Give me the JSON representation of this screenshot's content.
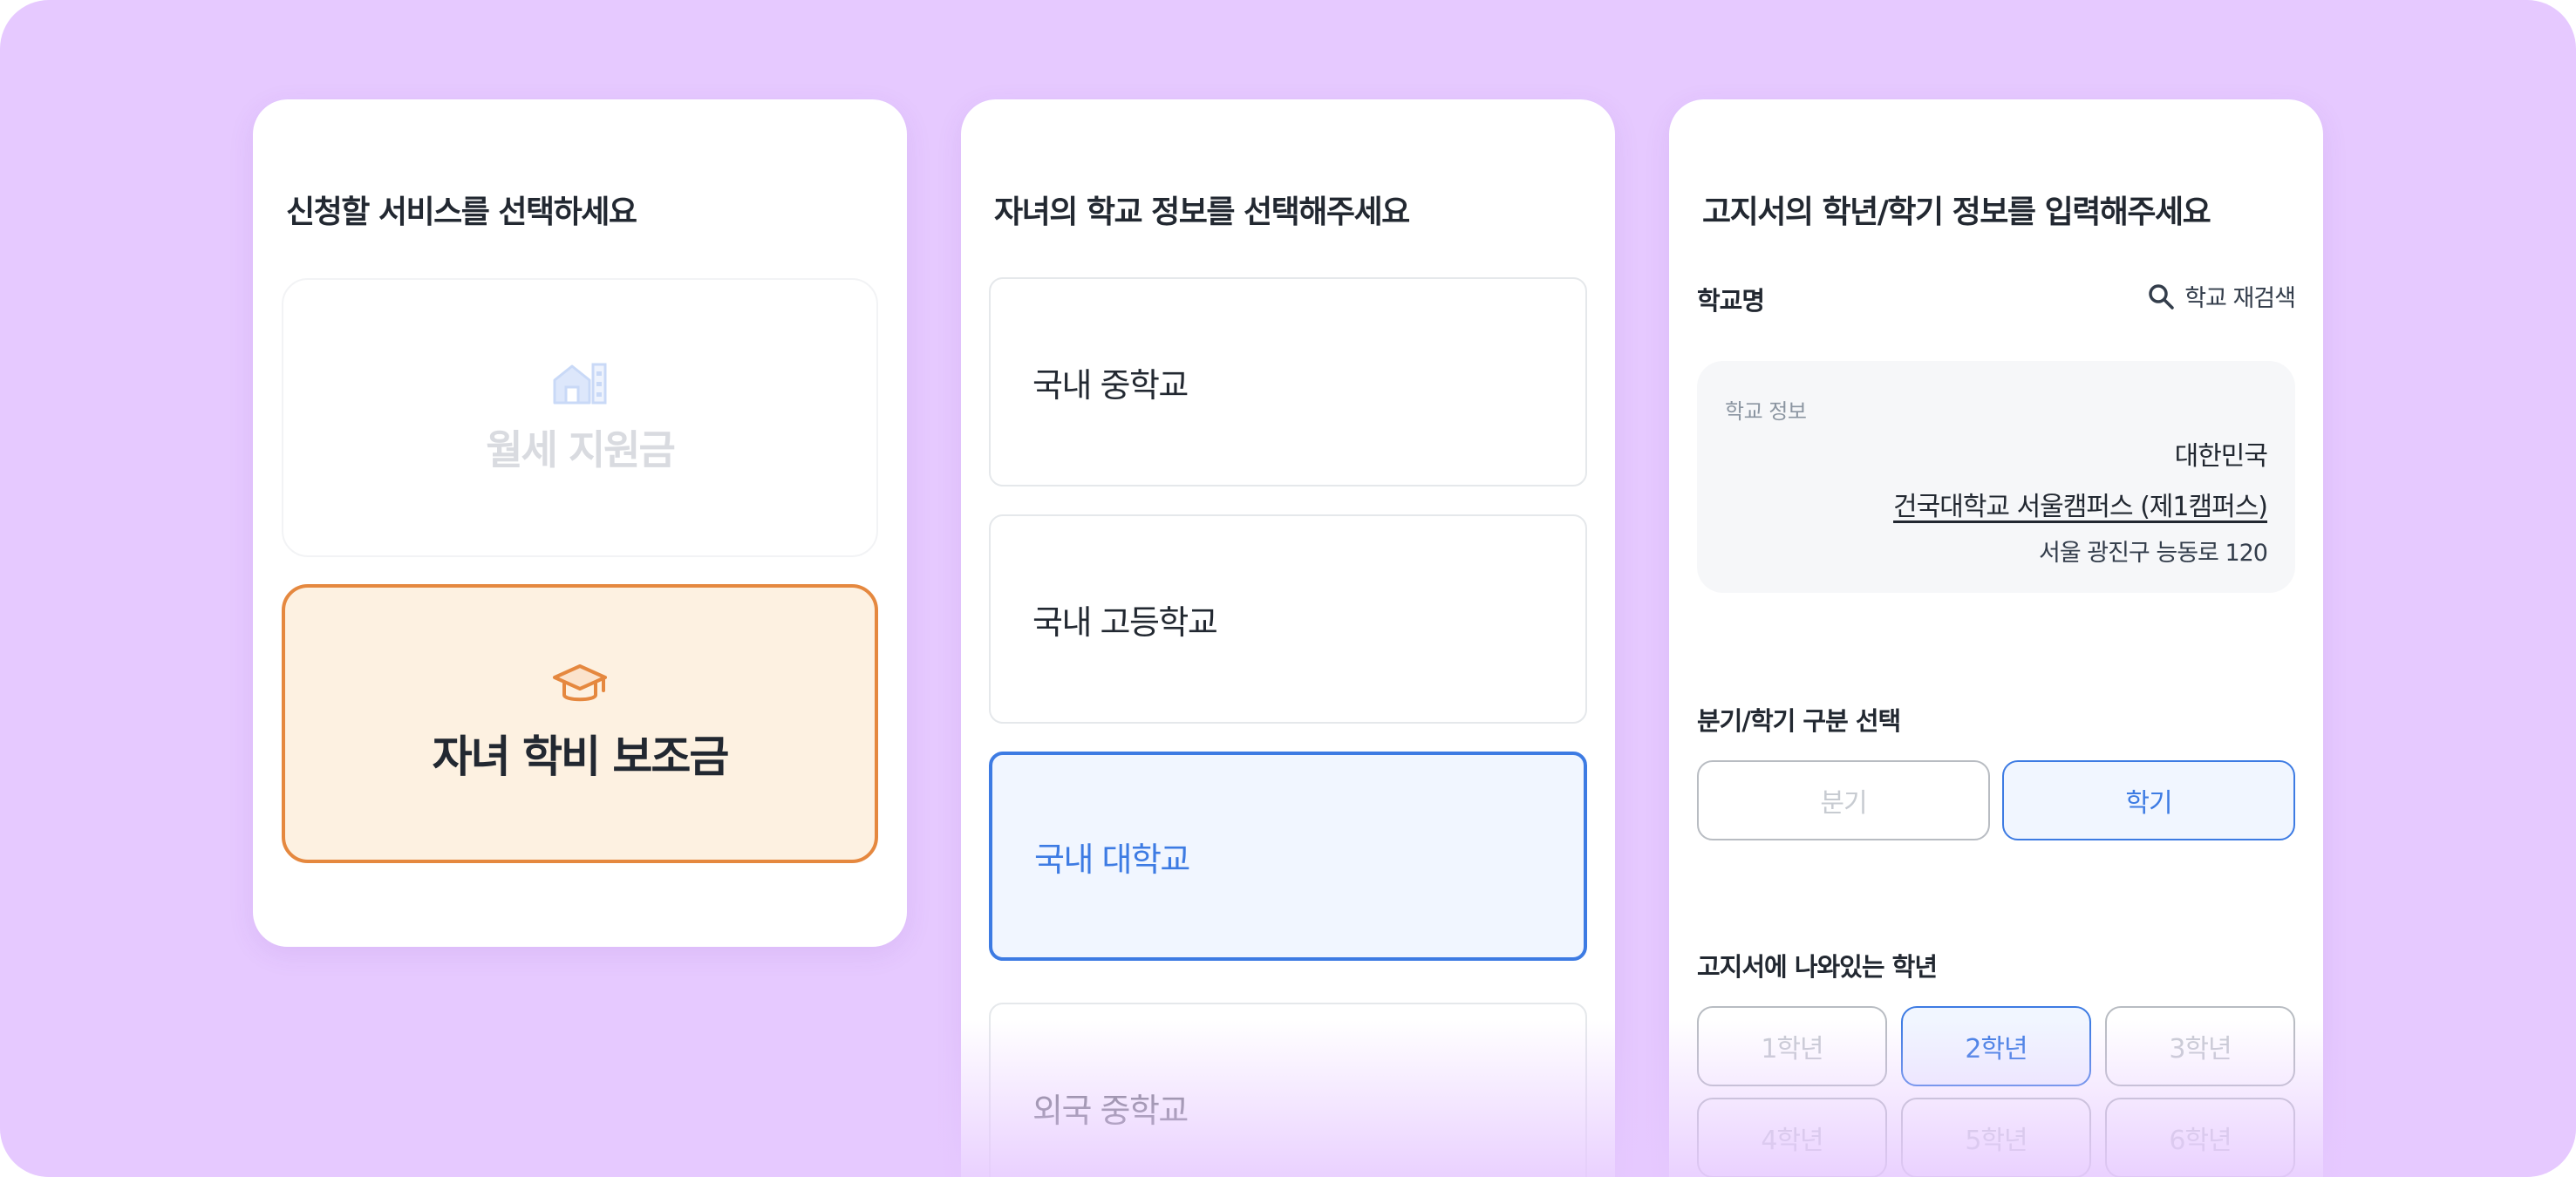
{
  "colors": {
    "background": "#e6c9ff",
    "accent_blue": "#3d7be3",
    "accent_orange": "#e5883f",
    "selected_fill_blue": "#f1f6ff",
    "selected_fill_orange": "#fdf1e1"
  },
  "service_panel": {
    "title": "신청할 서비스를 선택하세요",
    "options": [
      {
        "label": "월세 지원금",
        "icon": "building-icon",
        "selected": false
      },
      {
        "label": "자녀 학비 보조금",
        "icon": "graduation-cap-icon",
        "selected": true
      }
    ]
  },
  "school_type_panel": {
    "title": "자녀의 학교 정보를 선택해주세요",
    "options": [
      {
        "label": "국내 중학교",
        "selected": false
      },
      {
        "label": "국내 고등학교",
        "selected": false
      },
      {
        "label": "국내 대학교",
        "selected": true
      },
      {
        "label": "외국 중학교",
        "selected": false
      }
    ]
  },
  "grade_panel": {
    "title": "고지서의 학년/학기 정보를 입력해주세요",
    "school_name_label": "학교명",
    "research_button": {
      "label": "학교 재검색",
      "icon": "search-icon"
    },
    "school_info": {
      "title": "학교 정보",
      "country": "대한민국",
      "name": "건국대학교 서울캠퍼스 (제1캠퍼스)",
      "address": "서울 광진구 능동로 120"
    },
    "term_label": "분기/학기 구분 선택",
    "term_options": [
      {
        "label": "분기",
        "selected": false
      },
      {
        "label": "학기",
        "selected": true
      }
    ],
    "grade_label": "고지서에 나와있는 학년",
    "grades": [
      {
        "label": "1학년",
        "selected": false
      },
      {
        "label": "2학년",
        "selected": true
      },
      {
        "label": "3학년",
        "selected": false
      },
      {
        "label": "4학년",
        "selected": false
      },
      {
        "label": "5학년",
        "selected": false
      },
      {
        "label": "6학년",
        "selected": false
      }
    ]
  }
}
